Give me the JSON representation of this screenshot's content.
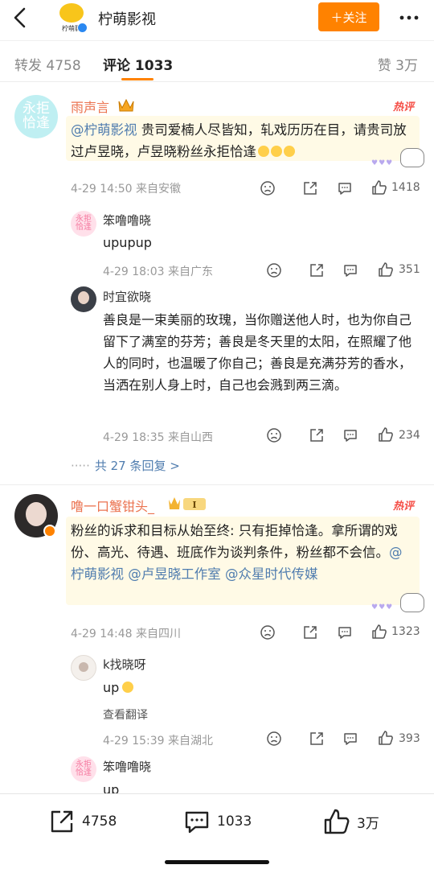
{
  "header": {
    "account_name": "柠萌影视",
    "logo_text": "柠萌影",
    "follow_label": "＋关注",
    "icons": {
      "back": "chevron-left-icon",
      "more": "more-dots-icon",
      "verified": "verified-badge-icon"
    }
  },
  "tabs": [
    {
      "label": "转发 4758"
    },
    {
      "label": "评论 1033"
    },
    {
      "label": "赞 3万"
    }
  ],
  "accent_color": "#ff8200",
  "comments": [
    {
      "avatar_text": "永拒\n恰逢",
      "author": "雨声言",
      "badge": "hot",
      "badge_label": "热评",
      "mention": "@柠萌影视",
      "text": "贵司爱楠人尽皆知，轧戏历历在目，请贵司放过卢昱晓，卢昱晓粉丝永拒恰逢",
      "time_location": "4-29 14:50  来自安徽",
      "likes": "1418",
      "replies": [
        {
          "avatar_text": "永拒\n恰逢",
          "author": "笨噜噜晓",
          "text": "upupup",
          "time_location": "4-29 18:03  来自广东",
          "likes": "351"
        },
        {
          "author": "时宜欲晓",
          "text": "善良是一束美丽的玫瑰，当你赠送他人时，也为你自己留下了满室的芬芳；善良是冬天里的太阳，在照耀了他人的同时，也温暖了你自己；善良是充满芬芳的香水，当洒在别人身上时，自己也会溅到两三滴。",
          "time_location": "4-29 18:35  来自山西",
          "likes": "234"
        }
      ],
      "more_replies": "共 27 条回复 >"
    },
    {
      "author": "噜一口蟹钳头_",
      "badge": "hot",
      "badge_label": "热评",
      "text_before": "粉丝的诉求和目标从始至终: 只有拒掉恰逢。拿所谓的戏份、高光、待遇、班底作为谈判条件，粉丝都不会信。",
      "mentions": [
        "@柠萌影视",
        "@卢昱晓工作室",
        "@众星时代传媒"
      ],
      "time_location": "4-29 14:48  来自四川",
      "likes": "1323",
      "replies": [
        {
          "author": "k找晓呀",
          "text": "up",
          "translate_label": "查看翻译",
          "time_location": "4-29 15:39  来自湖北",
          "likes": "393"
        },
        {
          "avatar_text": "永拒\n恰逢",
          "author": "笨噜噜晓",
          "text": "up"
        }
      ]
    }
  ],
  "bottom_bar": {
    "repost_count": "4758",
    "comment_count": "1033",
    "like_count": "3万"
  }
}
